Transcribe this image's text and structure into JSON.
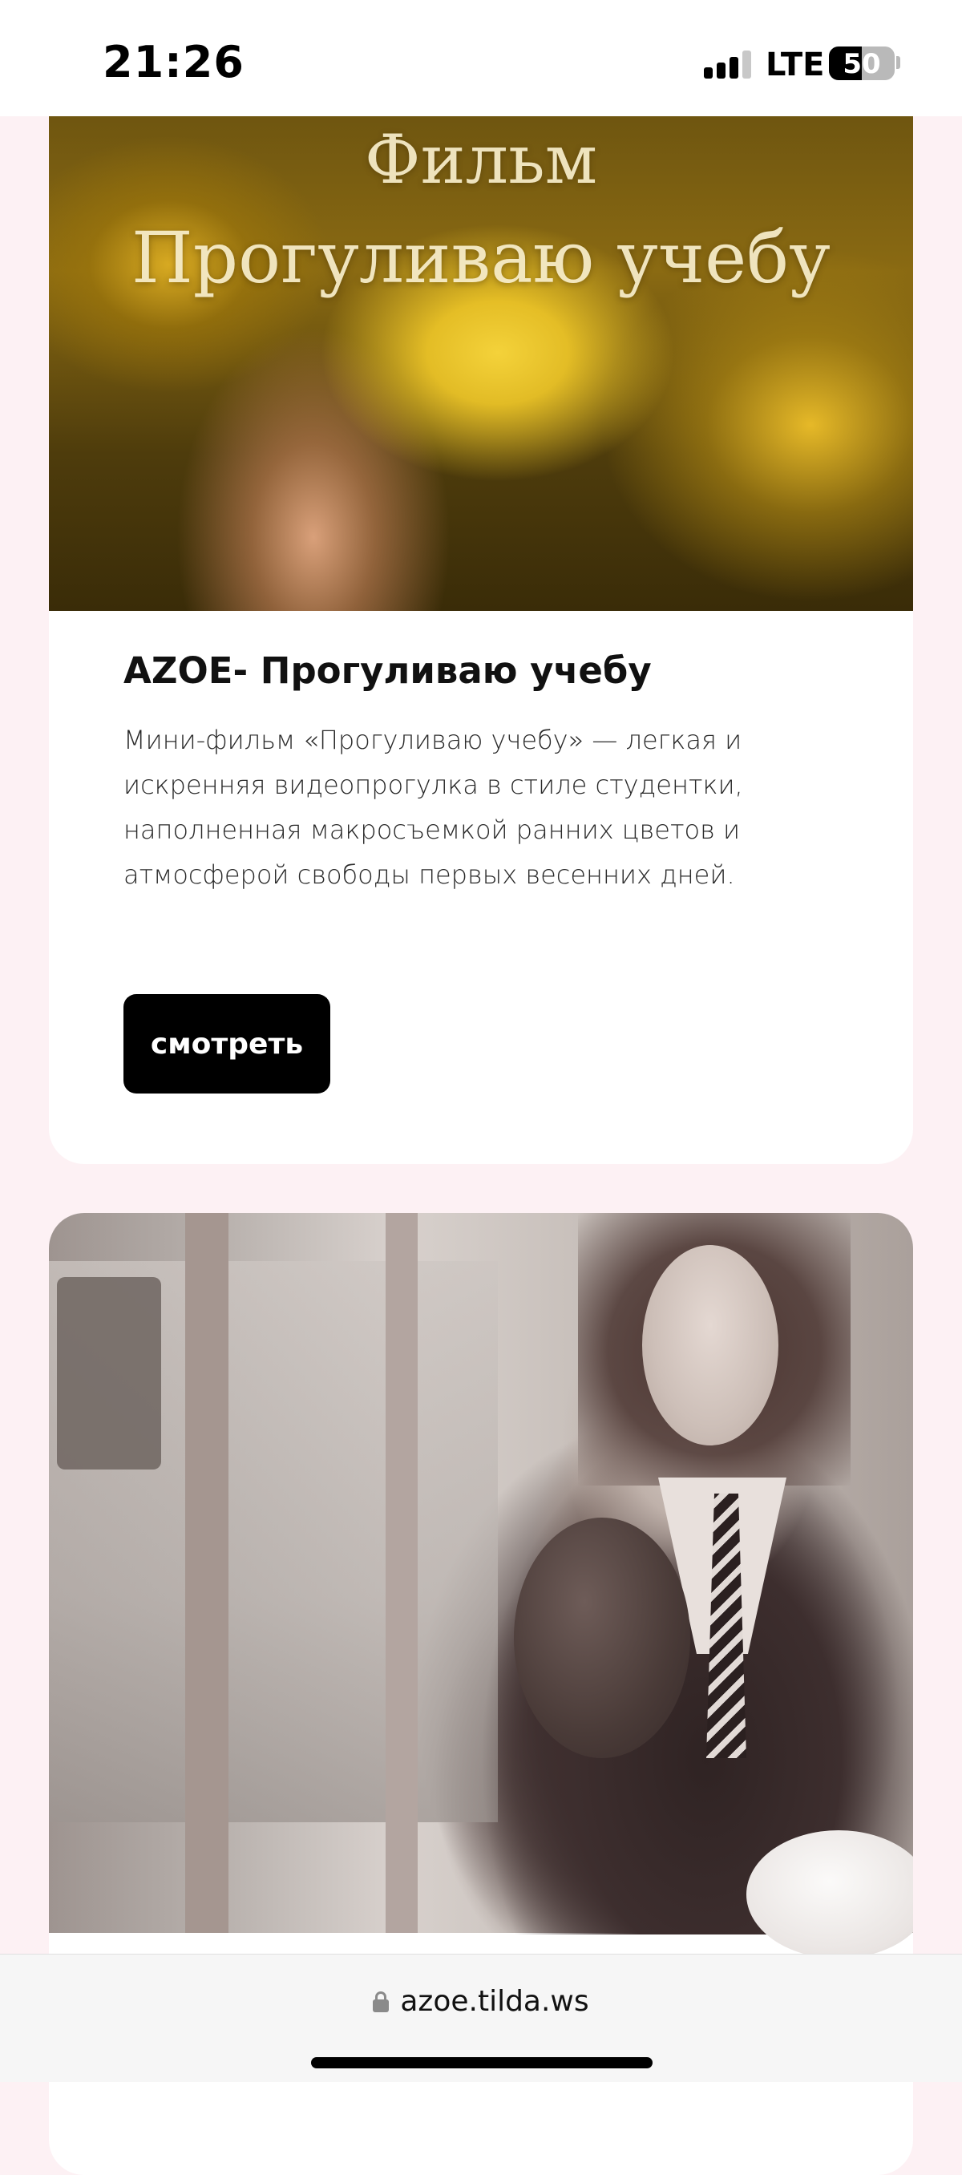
{
  "status_bar": {
    "time": "21:26",
    "network": "LTE",
    "battery_level": "50",
    "battery_fraction": 0.5
  },
  "cards": [
    {
      "cover_title_line1": "Фильм",
      "cover_title_line2": "Прогуливаю учебу",
      "title": "AZOE- Прогуливаю учебу",
      "description": "Мини-фильм «Прогуливаю учебу» — легкая и искренняя видеопрогулка в стиле студентки, наполненная макросъемкой ранних цветов и атмосферой свободы первых весенних дней.",
      "button_label": "смотреть"
    }
  ],
  "browser": {
    "address": "azoe.tilda.ws"
  }
}
